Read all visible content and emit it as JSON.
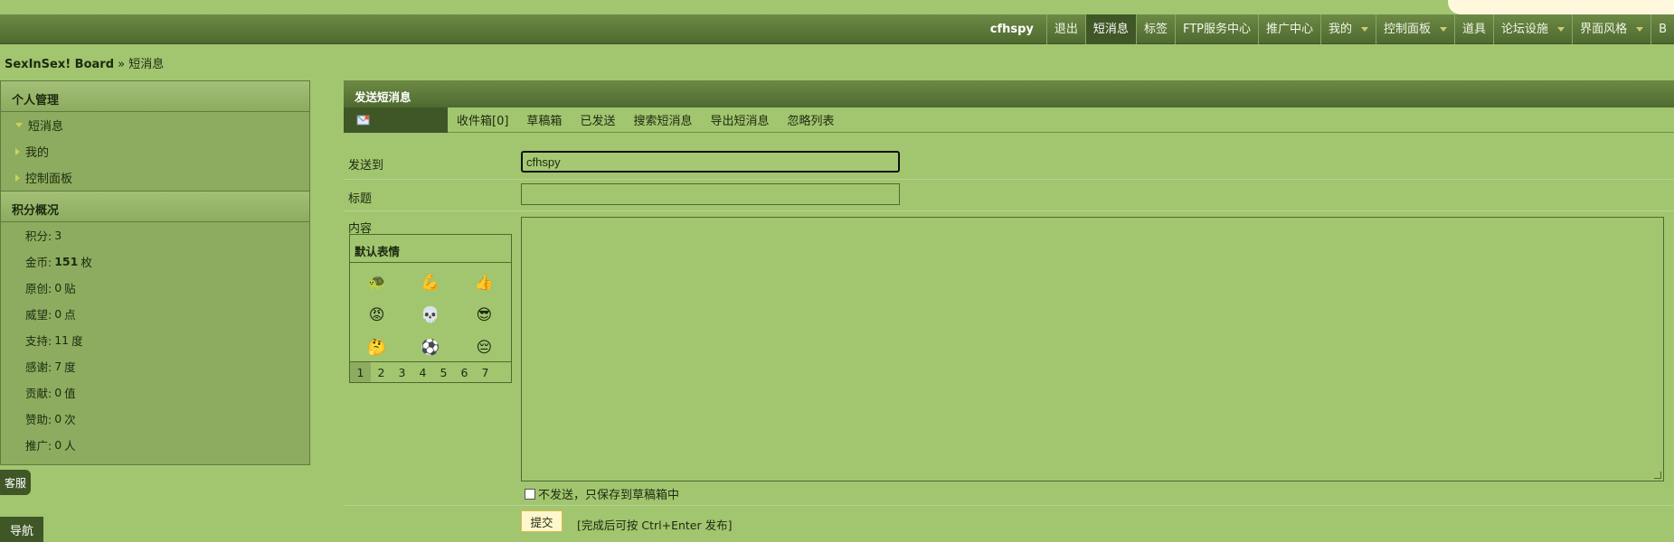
{
  "navbar": {
    "username": "cfhspy",
    "items": [
      {
        "label": "退出",
        "dropdown": false
      },
      {
        "label": "短消息",
        "dropdown": false,
        "active": true
      },
      {
        "label": "标签",
        "dropdown": false
      },
      {
        "label": "FTP服务中心",
        "dropdown": false
      },
      {
        "label": "推广中心",
        "dropdown": false
      },
      {
        "label": "我的",
        "dropdown": true
      },
      {
        "label": "控制面板",
        "dropdown": true
      },
      {
        "label": "道具",
        "dropdown": false
      },
      {
        "label": "论坛设施",
        "dropdown": true
      },
      {
        "label": "界面风格",
        "dropdown": true
      },
      {
        "label": "B",
        "dropdown": false
      }
    ]
  },
  "breadcrumb": {
    "home": "SexInSex! Board",
    "sep": "»",
    "current": "短消息"
  },
  "sidebar": {
    "section1_title": "个人管理",
    "items": [
      {
        "label": "短消息",
        "expanded": true
      },
      {
        "label": "我的",
        "expanded": false
      },
      {
        "label": "控制面板",
        "expanded": false
      }
    ],
    "section2_title": "积分概况",
    "stats": [
      {
        "label": "积分:",
        "value": "3",
        "unit": ""
      },
      {
        "label": "金币:",
        "value": "151",
        "unit": "枚",
        "bold": true
      },
      {
        "label": "原创:",
        "value": "0",
        "unit": "贴"
      },
      {
        "label": "威望:",
        "value": "0",
        "unit": "点"
      },
      {
        "label": "支持:",
        "value": "11",
        "unit": "度"
      },
      {
        "label": "感谢:",
        "value": "7",
        "unit": "度"
      },
      {
        "label": "贡献:",
        "value": "0",
        "unit": "值"
      },
      {
        "label": "赞助:",
        "value": "0",
        "unit": "次"
      },
      {
        "label": "推广:",
        "value": "0",
        "unit": "人"
      }
    ]
  },
  "buttons": {
    "kefu": "客服",
    "daohang": "导航"
  },
  "main": {
    "title": "发送短消息",
    "tabs": [
      "收件箱[0]",
      "草稿箱",
      "已发送",
      "搜索短消息",
      "导出短消息",
      "忽略列表"
    ],
    "form": {
      "to_label": "发送到",
      "to_value": "cfhspy",
      "subject_label": "标题",
      "subject_value": "",
      "content_label": "内容",
      "smiley_title": "默认表情",
      "smileys": [
        "turtle-icon",
        "blue-arm-icon",
        "thumbs-up-icon",
        "angry-face-icon",
        "skull-icon",
        "cool-face-icon",
        "thinking-face-icon",
        "soccer-ball-icon",
        "sleepy-face-icon"
      ],
      "smiley_glyphs": [
        "🐢",
        "💪",
        "👍",
        "😡",
        "💀",
        "😎",
        "🤔",
        "⚽",
        "😔"
      ],
      "smiley_pages": [
        "1",
        "2",
        "3",
        "4",
        "5",
        "6",
        "7"
      ],
      "draft_checkbox_label": "不发送，只保存到草稿箱中",
      "submit_label": "提交",
      "hint": "[完成后可按 Ctrl+Enter 发布]"
    }
  }
}
